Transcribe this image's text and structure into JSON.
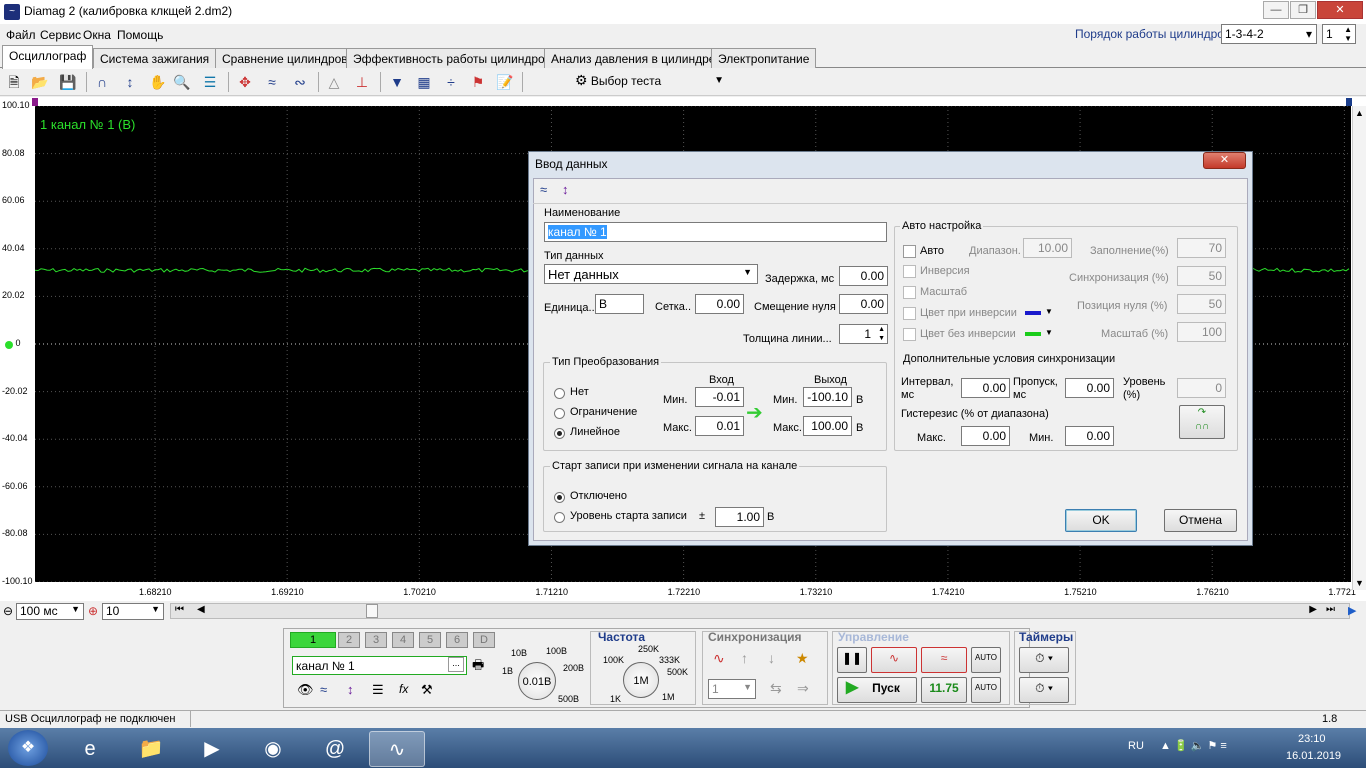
{
  "window": {
    "title": "Diamag 2 (калибровка клкщей 2.dm2)"
  },
  "menu": [
    "Файл",
    "Сервис",
    "Окна",
    "Помощь"
  ],
  "cyl_order": {
    "label": "Порядок работы цилиндров",
    "value": "1-3-4-2",
    "count": "1"
  },
  "tabs": [
    "Осциллограф",
    "Система зажигания",
    "Сравнение цилиндров",
    "Эффективность работы цилиндров",
    "Анализ давления в цилиндре",
    "Электропитание"
  ],
  "toolbar": {
    "test_select": "Выбор теста"
  },
  "scope": {
    "channel_label": "1  канал № 1 (В)",
    "y_ticks": [
      "100.10",
      "80.08",
      "60.06",
      "40.04",
      "20.02",
      "0",
      "-20.02",
      "-40.04",
      "-60.06",
      "-80.08",
      "-100.10"
    ],
    "x_ticks": [
      "1.68210",
      "1.69210",
      "1.70210",
      "1.71210",
      "1.72210",
      "1.73210",
      "1.74210",
      "1.75210",
      "1.76210",
      "1.7721"
    ],
    "signal_level": 31,
    "ylim": [
      -100.1,
      100.1
    ],
    "trace_color": "#2bdf2b"
  },
  "timebase": {
    "value": "100 мс",
    "points": "10"
  },
  "dialog": {
    "title": "Ввод данных",
    "name_label": "Наименование",
    "name_value": "канал № 1",
    "type_label": "Тип данных",
    "type_value": "Нет данных",
    "delay_label": "Задержка, мс",
    "delay_value": "0.00",
    "unit_label": "Единица..",
    "unit_value": "В",
    "grid_label": "Сетка..",
    "grid_value": "0.00",
    "zero_label": "Смещение нуля",
    "zero_value": "0.00",
    "line_label": "Толщина линии...",
    "line_value": "1",
    "conv": {
      "title": "Тип Преобразования",
      "opts": [
        "Нет",
        "Ограничение",
        "Линейное"
      ],
      "in_label": "Вход",
      "out_label": "Выход",
      "min_label": "Мин.",
      "max_label": "Макс.",
      "in_min": "-0.01",
      "in_max": "0.01",
      "out_min": "-100.10",
      "out_max": "100.00",
      "unit": "В"
    },
    "rec": {
      "title": "Старт записи при изменении сигнала на канале",
      "off": "Отключено",
      "level": "Уровень старта записи",
      "pm": "±",
      "level_value": "1.00",
      "unit": "В"
    },
    "auto": {
      "title": "Авто настройка",
      "auto": "Авто",
      "range_label": "Диапазон.",
      "range_value": "10.00",
      "fill_label": "Заполнение(%)",
      "fill_value": "70",
      "inv": "Инверсия",
      "sync_label": "Синхронизация (%)",
      "sync_value": "50",
      "scale": "Масштаб",
      "zeropos_label": "Позиция нуля (%)",
      "zeropos_value": "50",
      "inv_color": "Цвет при инверсии",
      "noinv_color": "Цвет без инверсии",
      "scale_label": "Масштаб (%)",
      "scale_value": "100"
    },
    "extra": {
      "title": "Дополнительные условия синхронизации",
      "interval": "Интервал,",
      "ms": "мс",
      "interval_value": "0.00",
      "skip": "Пропуск,",
      "skip_value": "0.00",
      "level": "Уровень",
      "pct": "(%)",
      "level_value": "0",
      "hyst": "Гистерезис (% от диапазона)",
      "max": "Макс.",
      "max_value": "0.00",
      "min": "Мин.",
      "min_value": "0.00"
    },
    "ok": "OK",
    "cancel": "Отмена"
  },
  "bottom": {
    "channels": [
      "1",
      "2",
      "3",
      "4",
      "5",
      "6",
      "D"
    ],
    "chan_name": "канал № 1",
    "volt_knob": "0.01В",
    "volt_marks": [
      "10В",
      "100В",
      "1В",
      "200В",
      "500В"
    ],
    "freq_title": "Частота",
    "freq_knob": "1M",
    "freq_marks": [
      "250K",
      "100K",
      "333K",
      "500K",
      "1K",
      "1M"
    ],
    "sync_title": "Синхронизация",
    "sync_val": "1",
    "control_title": "Управление",
    "start": "Пуск",
    "value": "11.75",
    "timers_title": "Таймеры"
  },
  "status": {
    "text": "USB Осциллограф не подключен",
    "version": "1.8"
  },
  "tray": {
    "lang": "RU",
    "time": "23:10",
    "date": "16.01.2019"
  }
}
